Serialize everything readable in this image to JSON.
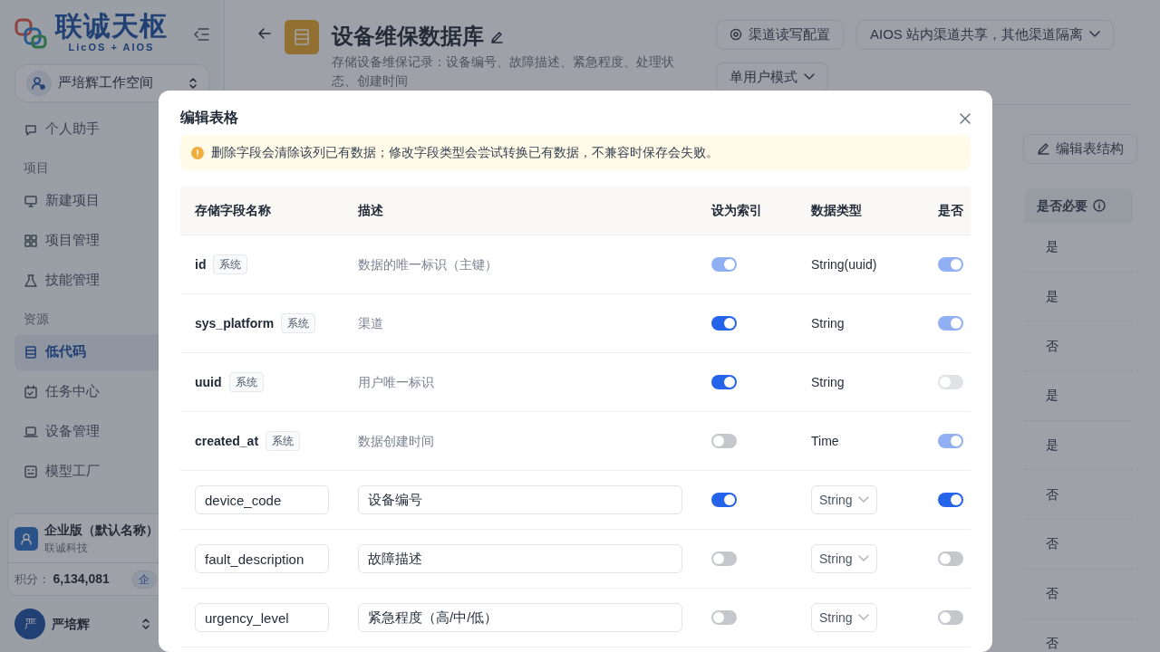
{
  "sidebar": {
    "logo": {
      "title": "联诚天枢",
      "subtitle": "LicOS + AIOS"
    },
    "workspace": "严培辉工作空间",
    "items": [
      {
        "kind": "item",
        "label": "个人助手",
        "selected": false
      },
      {
        "kind": "section",
        "label": "项目"
      },
      {
        "kind": "item",
        "label": "新建项目",
        "selected": false
      },
      {
        "kind": "item",
        "label": "项目管理",
        "selected": false
      },
      {
        "kind": "item",
        "label": "技能管理",
        "selected": false
      },
      {
        "kind": "section",
        "label": "资源"
      },
      {
        "kind": "item",
        "label": "低代码",
        "selected": true
      },
      {
        "kind": "item",
        "label": "任务中心",
        "selected": false
      },
      {
        "kind": "item",
        "label": "设备管理",
        "selected": false
      },
      {
        "kind": "item",
        "label": "模型工厂",
        "selected": false
      }
    ],
    "org": {
      "name": "企业版（默认名称）",
      "company": "联诚科技",
      "points_label": "积分：",
      "points": "6,134,081",
      "badge": "企"
    },
    "user": {
      "avatar": "严",
      "name": "严培辉"
    }
  },
  "header": {
    "title": "设备维保数据库",
    "description": "存储设备维保记录：设备编号、故障描述、紧急程度、处理状态、创建时间",
    "config_button": "渠道读写配置",
    "dropdowns": [
      "AIOS 站内渠道共享，其他渠道隔离",
      "单用户模式"
    ],
    "edit_schema_button": "编辑表结构"
  },
  "background_table": {
    "column": "是否必要",
    "values": [
      "是",
      "是",
      "否",
      "是",
      "是",
      "否",
      "否",
      "否",
      "否"
    ]
  },
  "dialog": {
    "title": "编辑表格",
    "warning": "删除字段会清除该列已有数据；修改字段类型会尝试转换已有数据，不兼容时保存会失败。",
    "columns": [
      "存储字段名称",
      "描述",
      "设为索引",
      "数据类型",
      "是否"
    ],
    "rows": [
      {
        "kind": "system",
        "name": "id",
        "tag": "系统",
        "description": "数据的唯一标识（主键）",
        "index": {
          "on": true,
          "disabled": true
        },
        "type": "String(uuid)",
        "required": {
          "on": true,
          "disabled": true
        }
      },
      {
        "kind": "system",
        "name": "sys_platform",
        "tag": "系统",
        "description": "渠道",
        "index": {
          "on": true,
          "disabled": false
        },
        "type": "String",
        "required": {
          "on": true,
          "disabled": true
        }
      },
      {
        "kind": "system",
        "name": "uuid",
        "tag": "系统",
        "description": "用户唯一标识",
        "index": {
          "on": true,
          "disabled": false
        },
        "type": "String",
        "required": {
          "on": false,
          "disabled": true
        }
      },
      {
        "kind": "system",
        "name": "created_at",
        "tag": "系统",
        "description": "数据创建时间",
        "index": {
          "on": false,
          "disabled": false
        },
        "type": "Time",
        "required": {
          "on": true,
          "disabled": true
        }
      },
      {
        "kind": "custom",
        "name": "device_code",
        "description": "设备编号",
        "index": {
          "on": true,
          "disabled": false
        },
        "type": "String",
        "required": {
          "on": true,
          "disabled": false
        }
      },
      {
        "kind": "custom",
        "name": "fault_description",
        "description": "故障描述",
        "index": {
          "on": false,
          "disabled": false
        },
        "type": "String",
        "required": {
          "on": false,
          "disabled": false
        }
      },
      {
        "kind": "custom",
        "name": "urgency_level",
        "description": "紧急程度（高/中/低）",
        "index": {
          "on": false,
          "disabled": false
        },
        "type": "String",
        "required": {
          "on": false,
          "disabled": false
        }
      }
    ]
  }
}
